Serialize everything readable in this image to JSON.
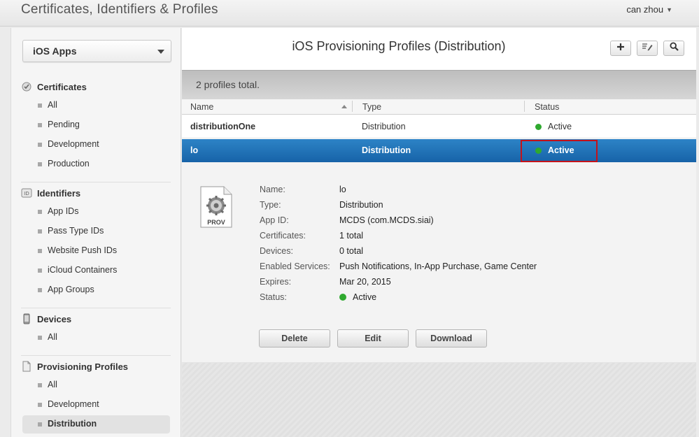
{
  "header": {
    "title": "Certificates, Identifiers & Profiles",
    "user": "can zhou"
  },
  "sidebar": {
    "platform": "iOS Apps",
    "sections": [
      {
        "title": "Certificates",
        "icon": "certificate-icon",
        "items": [
          "All",
          "Pending",
          "Development",
          "Production"
        ]
      },
      {
        "title": "Identifiers",
        "icon": "id-badge-icon",
        "items": [
          "App IDs",
          "Pass Type IDs",
          "Website Push IDs",
          "iCloud Containers",
          "App Groups"
        ]
      },
      {
        "title": "Devices",
        "icon": "device-icon",
        "items": [
          "All"
        ]
      },
      {
        "title": "Provisioning Profiles",
        "icon": "document-icon",
        "items": [
          "All",
          "Development",
          "Distribution"
        ],
        "active_item": "Distribution"
      }
    ]
  },
  "main": {
    "title": "iOS Provisioning Profiles (Distribution)",
    "toolbar": {
      "add_icon": "plus-icon",
      "edit_icon": "edit-icon",
      "search_icon": "search-icon"
    },
    "summary": "2 profiles total.",
    "columns": [
      "Name",
      "Type",
      "Status"
    ],
    "rows": [
      {
        "name": "distributionOne",
        "type": "Distribution",
        "status": "Active"
      },
      {
        "name": "lo",
        "type": "Distribution",
        "status": "Active"
      }
    ],
    "selected_row": 1,
    "detail": {
      "icon_label": "PROV",
      "fields": [
        {
          "label": "Name:",
          "value": "lo"
        },
        {
          "label": "Type:",
          "value": "Distribution"
        },
        {
          "label": "App ID:",
          "value": "MCDS (com.MCDS.siai)"
        },
        {
          "label": "Certificates:",
          "value": "1 total"
        },
        {
          "label": "Devices:",
          "value": "0 total"
        },
        {
          "label": "Enabled Services:",
          "value": "Push Notifications, In-App Purchase, Game Center"
        },
        {
          "label": "Expires:",
          "value": "Mar 20, 2015"
        },
        {
          "label": "Status:",
          "value": "Active"
        }
      ],
      "buttons": {
        "delete": "Delete",
        "edit": "Edit",
        "download": "Download"
      }
    }
  },
  "colors": {
    "selected_row": "#1f6fb6",
    "status_active": "#2fa92f",
    "highlight_box": "#c4121a"
  }
}
